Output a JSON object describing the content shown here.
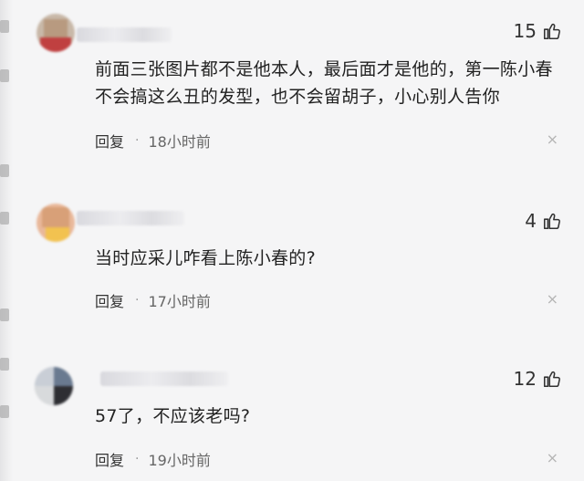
{
  "comments": [
    {
      "likes": "15",
      "text": "前面三张图片都不是他本人，最后面才是他的，第一陈小春不会搞这么丑的发型，也不会留胡子，小心别人告你",
      "reply_label": "回复",
      "separator": "·",
      "time": "18小时前",
      "close_symbol": "×"
    },
    {
      "likes": "4",
      "text": "当时应采儿咋看上陈小春的?",
      "reply_label": "回复",
      "separator": "·",
      "time": "17小时前",
      "close_symbol": "×"
    },
    {
      "likes": "12",
      "text": "57了，不应该老吗?",
      "reply_label": "回复",
      "separator": "·",
      "time": "19小时前",
      "close_symbol": "×"
    }
  ],
  "colors": {
    "background": "#f5f5f6",
    "text": "#222222",
    "meta": "#666666",
    "close": "#b5b5b5"
  },
  "icons": [
    "thumbs-up-icon",
    "close-icon"
  ]
}
